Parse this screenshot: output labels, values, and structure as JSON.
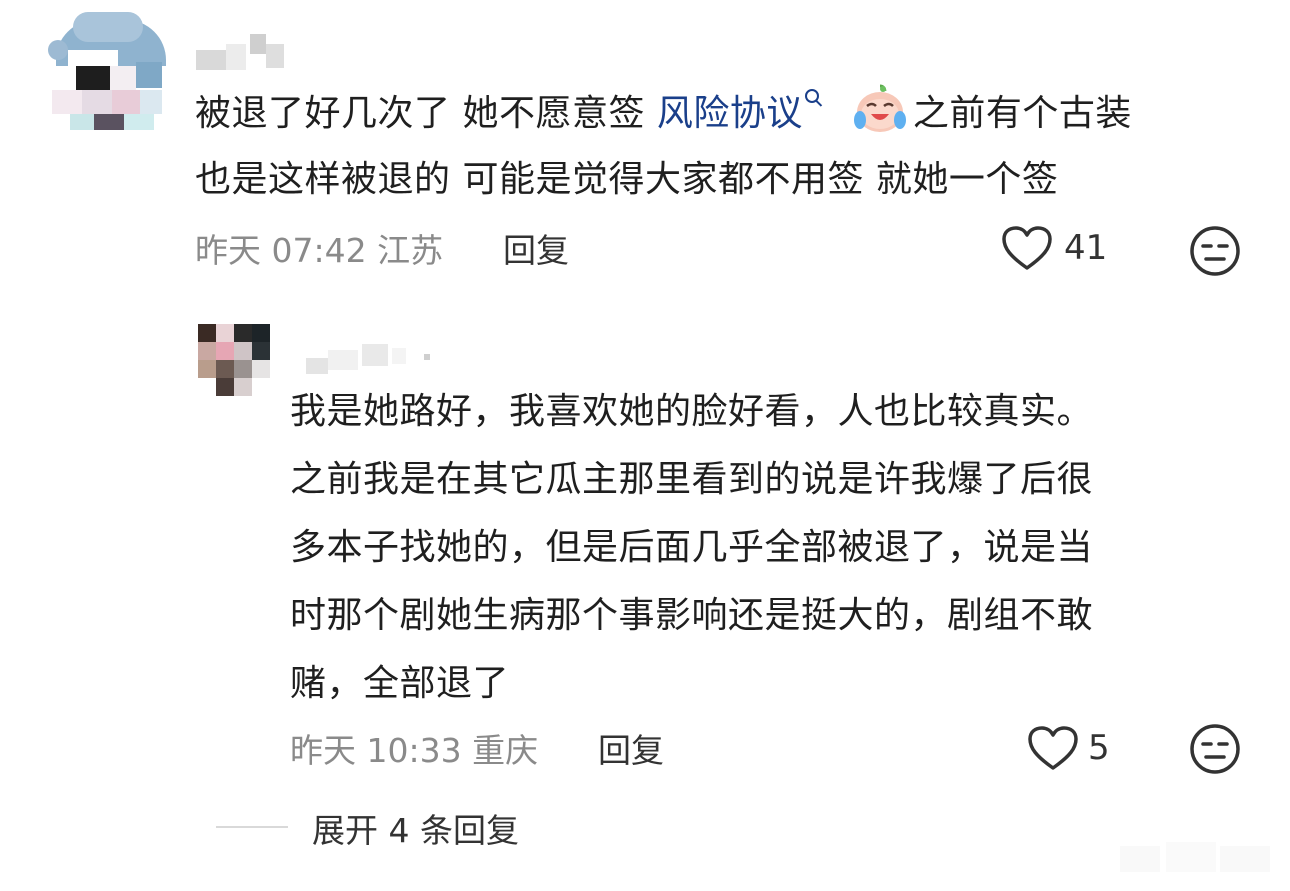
{
  "comment": {
    "text_line1_parts": {
      "before_link": "被退了好几次了 她不愿意签 ",
      "link": "风险协议",
      "after_emoji": "之前有个古装"
    },
    "text_line2": "也是这样被退的 可能是觉得大家都不用签 就她一个签",
    "time": "昨天 07:42 江苏",
    "reply_label": "回复",
    "likes": "41",
    "icons": [
      "search-icon",
      "crying-laughing-emoji",
      "heart-icon",
      "meh-face-icon"
    ]
  },
  "reply": {
    "lines": [
      "我是她路好，我喜欢她的脸好看，人也比较真实。",
      "之前我是在其它瓜主那里看到的说是许我爆了后很",
      "多本子找她的，但是后面几乎全部被退了，说是当",
      "时那个剧她生病那个事影响还是挺大的，剧组不敢",
      "赌，全部退了"
    ],
    "time": "昨天 10:33 重庆",
    "reply_label": "回复",
    "likes": "5"
  },
  "expand": {
    "label": "展开 4 条回复"
  },
  "colors": {
    "link": "#1a3f8a",
    "meta": "#8a8a8a",
    "text": "#1f1f1f"
  }
}
